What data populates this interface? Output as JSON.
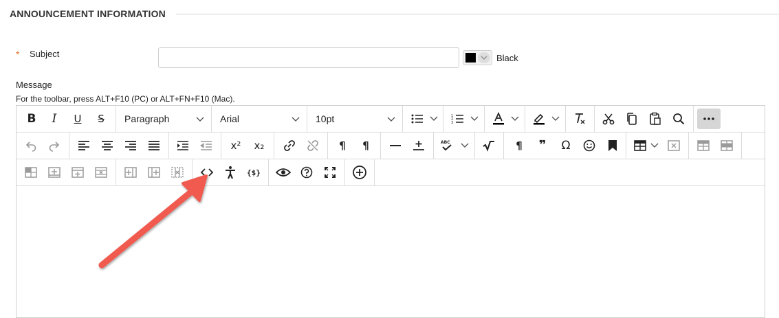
{
  "section": {
    "title": "ANNOUNCEMENT INFORMATION"
  },
  "subject": {
    "required_mark": "*",
    "label": "Subject",
    "value": ""
  },
  "color": {
    "swatch": "#000000",
    "name": "Black"
  },
  "message": {
    "label": "Message",
    "toolbar_hint": "For the toolbar, press ALT+F10 (PC) or ALT+FN+F10 (Mac)."
  },
  "toolbar": {
    "row1": {
      "bold": "B",
      "italic": "I",
      "underline": "U",
      "strike": "S",
      "block_format": "Paragraph",
      "font_family": "Arial",
      "font_size": "10pt",
      "clear_format": "T"
    },
    "row2": {
      "superscript": "x²",
      "subscript": "x₂",
      "ltr": "¶",
      "rtl": "¶",
      "pilcrow": "¶",
      "quote": "❞",
      "omega": "Ω"
    },
    "row3": {}
  },
  "accent": {
    "annotation_arrow": "#f05a4f",
    "active_button": "#d6d6d6"
  },
  "icons": [
    "bold-icon",
    "italic-icon",
    "underline-icon",
    "strikethrough-icon",
    "bullet-list-icon",
    "numbered-list-icon",
    "text-color-icon",
    "highlight-icon",
    "clear-formatting-icon",
    "cut-icon",
    "copy-icon",
    "paste-icon",
    "search-icon",
    "more-icon",
    "undo-icon",
    "redo-icon",
    "align-left-icon",
    "align-center-icon",
    "align-right-icon",
    "justify-icon",
    "indent-icon",
    "outdent-icon",
    "superscript-icon",
    "subscript-icon",
    "link-icon",
    "unlink-icon",
    "ltr-icon",
    "rtl-icon",
    "horizontal-line-icon",
    "insert-below-icon",
    "spellcheck-icon",
    "math-icon",
    "pilcrow-icon",
    "quote-icon",
    "omega-icon",
    "emoji-icon",
    "bookmark-icon",
    "table-icon",
    "delete-table-icon",
    "table-props-icon",
    "cell-props-icon",
    "row-props-icon",
    "insert-row-before-icon",
    "insert-row-after-icon",
    "delete-row-icon",
    "insert-col-before-icon",
    "insert-col-after-icon",
    "delete-col-icon",
    "source-code-icon",
    "accessibility-icon",
    "template-variable-icon",
    "preview-icon",
    "help-icon",
    "fullscreen-icon",
    "add-content-icon"
  ]
}
